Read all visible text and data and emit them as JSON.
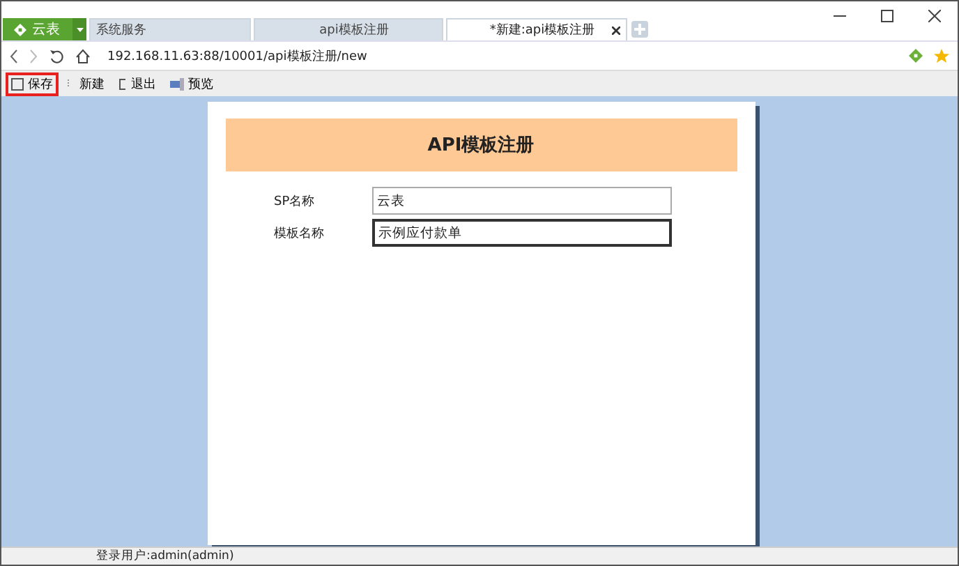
{
  "app_menu": {
    "label": "云表"
  },
  "tabs": [
    {
      "label": "系统服务",
      "selected": false,
      "closable": false
    },
    {
      "label": "api模板注册",
      "selected": false,
      "closable": false
    },
    {
      "label": "*新建:api模板注册",
      "selected": true,
      "closable": true
    }
  ],
  "address_bar": {
    "url": "192.168.11.63:88/10001/api模板注册/new"
  },
  "toolbar": [
    {
      "label": "保存",
      "kind": "save",
      "highlighted": true
    },
    {
      "label": "新建",
      "kind": "new",
      "highlighted": false
    },
    {
      "label": "退出",
      "kind": "exit",
      "highlighted": false
    },
    {
      "label": "预览",
      "kind": "preview",
      "highlighted": false
    }
  ],
  "form": {
    "title": "API模板注册",
    "fields": [
      {
        "label": "SP名称",
        "value": "云表",
        "focused": false
      },
      {
        "label": "模板名称",
        "value": "示例应付款单",
        "focused": true
      }
    ]
  },
  "status_bar": {
    "user": "登录用户:admin(admin)"
  }
}
